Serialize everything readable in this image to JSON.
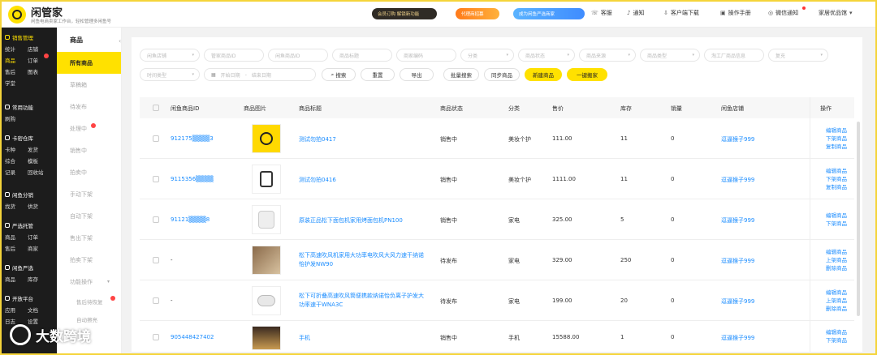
{
  "header": {
    "app_name": "闲管家",
    "app_subtitle": "闲鱼电商卖家工作台，轻松管理多闲鱼号",
    "pill_vip": "会员订购  解锁新功能",
    "pill_agent": "代理商招募",
    "pill_partner": "成为闲鱼严选商家",
    "links": [
      "客服",
      "通知",
      "客户端下载",
      "操作手册",
      "微信通知"
    ],
    "store_name": "家居优品馆"
  },
  "sidebar": {
    "groups": [
      {
        "title": "销售管理",
        "active": true,
        "items": [
          "统计",
          "店铺",
          "商品",
          "订单",
          "售后",
          "图表",
          "学堂"
        ]
      },
      {
        "title": "常用功能",
        "active": false,
        "items": [
          "刷购"
        ]
      },
      {
        "title": "卡密仓库",
        "active": false,
        "items": [
          "卡种",
          "发货",
          "综合",
          "模板",
          "记录",
          "回收站"
        ]
      },
      {
        "title": "闲鱼分销",
        "active": false,
        "items": [
          "找货",
          "供货"
        ]
      },
      {
        "title": "严选托管",
        "active": false,
        "items": [
          "商品",
          "订单",
          "售后",
          "商家"
        ]
      },
      {
        "title": "闲鱼严选",
        "active": false,
        "items": [
          "商品",
          "库存"
        ]
      },
      {
        "title": "开放平台",
        "active": false,
        "items": [
          "应用",
          "文档",
          "日志",
          "设置"
        ]
      }
    ]
  },
  "subnav": {
    "title": "商品",
    "items": [
      "所有商品",
      "草稿箱",
      "待发布",
      "处理中",
      "销售中",
      "拍卖中",
      "手动下架",
      "自动下架",
      "售出下架",
      "拍卖下架",
      "功能操作",
      "售后待恢复",
      "自动擦亮"
    ]
  },
  "filters": {
    "row1": [
      "闲鱼店铺",
      "管家商品ID",
      "闲鱼商品ID",
      "商品标题",
      "商家编码",
      "分类",
      "商品状态",
      "商品来源",
      "商品类型",
      "淘工厂商品信息",
      "复充"
    ],
    "row2_time_type": "时间类型",
    "start_date": "开始日期",
    "end_date": "结束日期",
    "buttons": [
      "搜索",
      "重置",
      "导出",
      "批量搜索",
      "同步商品",
      "新建商品",
      "一键搬家"
    ]
  },
  "table": {
    "columns": [
      "闲鱼商品ID",
      "商品图片",
      "商品标题",
      "商品状态",
      "分类",
      "售价",
      "库存",
      "销量",
      "闲鱼店铺",
      "操作"
    ],
    "rows": [
      {
        "id": "912175▒▒▒▒3",
        "title": "测试勿拍0417",
        "status": "销售中",
        "category": "美妆个护",
        "price": "111.00",
        "stock": "11",
        "sales": "0",
        "shop": "逗逼猴子999",
        "ops": [
          "编辑商品",
          "下架商品",
          "复制商品"
        ],
        "thumb": "yellow-logo"
      },
      {
        "id": "9115356▒▒▒▒",
        "title": "测试勿拍0416",
        "status": "销售中",
        "category": "美妆个护",
        "price": "1111.00",
        "stock": "11",
        "sales": "0",
        "shop": "逗逼猴子999",
        "ops": [
          "编辑商品",
          "下架商品",
          "复制商品"
        ],
        "thumb": "clipboard"
      },
      {
        "id": "91121▒▒▒▒8",
        "title": "原装正品松下面包机家用烤面包机PN100",
        "status": "销售中",
        "category": "家电",
        "price": "325.00",
        "stock": "5",
        "sales": "0",
        "shop": "逗逼猴子999",
        "ops": [
          "编辑商品",
          "下架商品"
        ],
        "thumb": "bread-maker"
      },
      {
        "id": "-",
        "title": "松下高速吹风机家用大功率电吹风大风力速干纳诺怡护发NW90",
        "status": "待发布",
        "category": "家电",
        "price": "329.00",
        "stock": "250",
        "sales": "0",
        "shop": "逗逼猴子999",
        "ops": [
          "编辑商品",
          "上架商品",
          "删除商品"
        ],
        "thumb": "hair-dryer-photo"
      },
      {
        "id": "-",
        "title": "松下可折叠高速吹风筒便携款纳诺怡负离子护发大功率速干WNA3C",
        "status": "待发布",
        "category": "家电",
        "price": "199.00",
        "stock": "20",
        "sales": "0",
        "shop": "逗逼猴子999",
        "ops": [
          "编辑商品",
          "上架商品",
          "删除商品"
        ],
        "thumb": "hair-dryer"
      },
      {
        "id": "905448427402",
        "title": "手机",
        "status": "销售中",
        "category": "手机",
        "price": "15588.00",
        "stock": "1",
        "sales": "0",
        "shop": "逗逼猴子999",
        "ops": [
          "编辑商品",
          "下架商品"
        ],
        "thumb": "phone"
      }
    ]
  },
  "watermark": "大数跨境",
  "colors": {
    "accent": "#ffe100",
    "link": "#1a8cff",
    "sidebar": "#1c1c1c"
  }
}
